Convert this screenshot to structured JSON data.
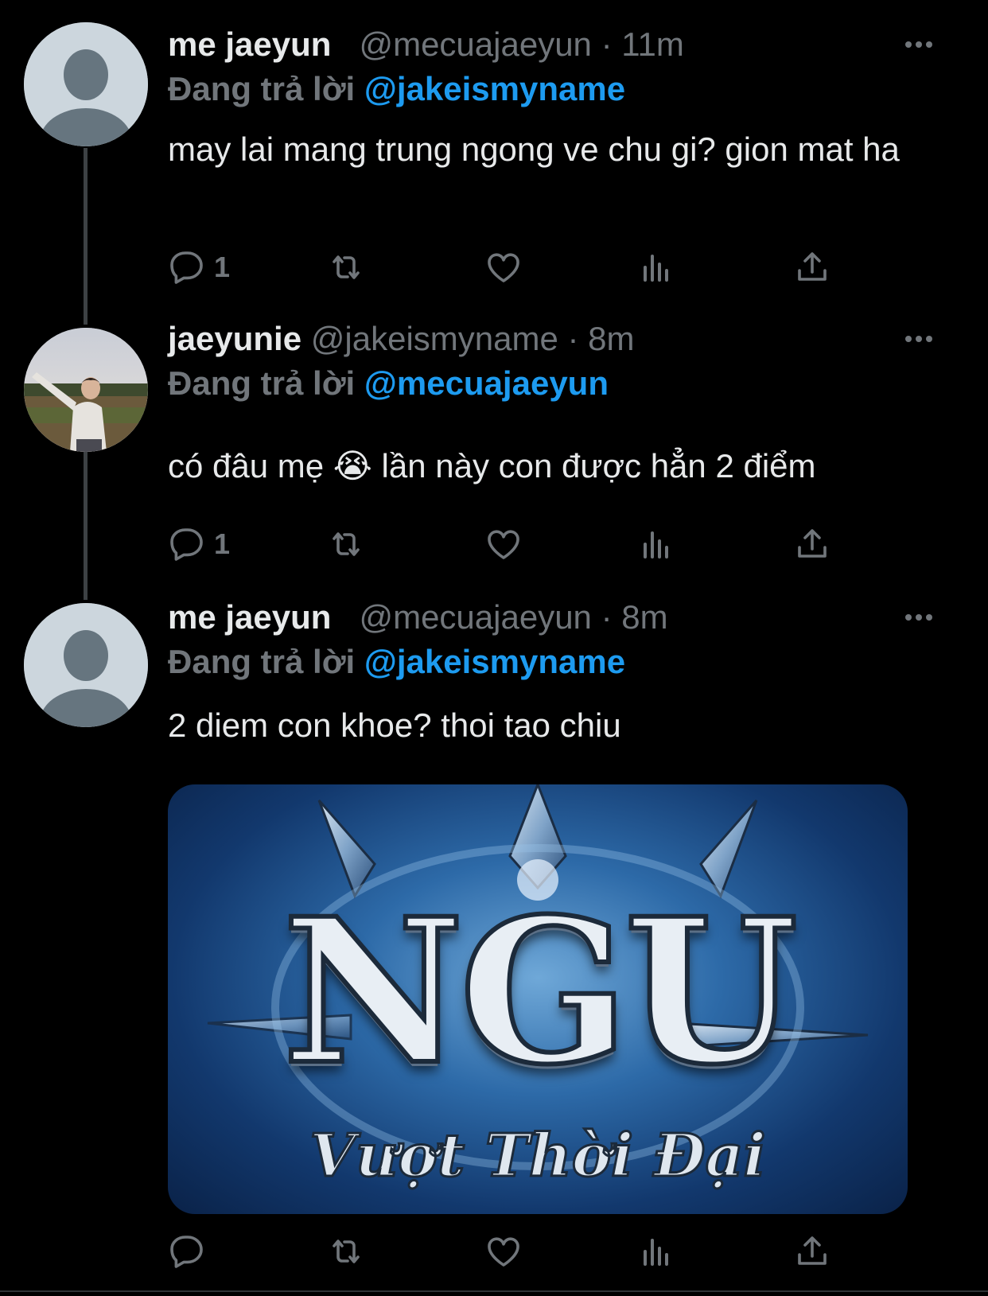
{
  "tweets": [
    {
      "name": "me jaeyun",
      "handle": "@mecuajaeyun",
      "separator": "·",
      "time": "11m",
      "replying_label": "Đang trả lời",
      "replying_to": "@jakeismyname",
      "text": "may lai mang trung ngong ve chu gi? gion mat ha",
      "reply_count": "1",
      "avatar": "default-avatar"
    },
    {
      "name": "jaeyunie",
      "handle": "@jakeismyname",
      "separator": "·",
      "time": "8m",
      "replying_label": "Đang trả lời",
      "replying_to": "@mecuajaeyun",
      "text": "có đâu mẹ 😭 lần này con được hẳn 2 điểm",
      "reply_count": "1",
      "avatar": "photo-avatar"
    },
    {
      "name": "me jaeyun",
      "handle": "@mecuajaeyun",
      "separator": "·",
      "time": "8m",
      "replying_label": "Đang trả lời",
      "replying_to": "@jakeismyname",
      "text": "2 diem con khoe? thoi tao chiu",
      "reply_count": "",
      "avatar": "default-avatar",
      "media": {
        "title": "NGU",
        "subtitle": "Vượt Thời Đại"
      }
    }
  ],
  "icons": [
    "reply-icon",
    "retweet-icon",
    "like-icon",
    "analytics-icon",
    "share-icon",
    "more-icon"
  ],
  "colors": {
    "background": "#000000",
    "text": "#e7e9ea",
    "secondary": "#71767b",
    "link": "#1d9bf0",
    "thread_line": "#3d4144"
  }
}
